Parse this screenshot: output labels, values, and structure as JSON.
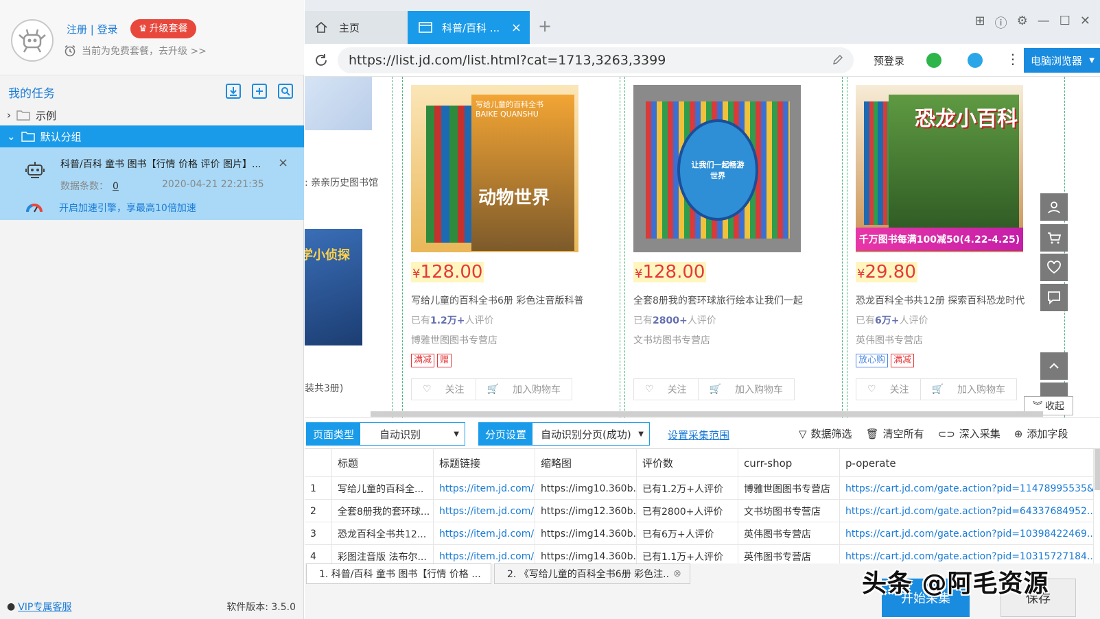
{
  "user": {
    "register": "注册",
    "sep": "|",
    "login": "登录",
    "upgrade": "升级套餐",
    "plan_text": "当前为免费套餐，去升级 >>"
  },
  "tasks": {
    "title": "我的任务",
    "example": "示例",
    "default_group": "默认分组",
    "task": {
      "title": "科普/百科 童书 图书【行情 价格 评价 图片】...",
      "count_label": "数据条数：",
      "count": "0",
      "time": "2020-04-21 22:21:35",
      "speed": "开启加速引擎，享最高10倍加速"
    }
  },
  "footer": {
    "vip": "VIP专属客服",
    "version": "软件版本: 3.5.0"
  },
  "browser": {
    "home_tab": "主页",
    "active_tab": "科普/百科 ...",
    "url": "https://list.jd.com/list.html?cat=1713,3263,3399",
    "prelogin": "预登录",
    "pc_browser": "电脑浏览器"
  },
  "web": {
    "left_shop": ": 亲亲历史图书馆",
    "left_note": "装共3册)",
    "left_book_title": "学小侦探",
    "products": [
      {
        "price_sym": "¥",
        "price": "128.00",
        "title": "写给儿童的百科全书6册 彩色注音版科普",
        "cmt_pre": "已有",
        "cmt": "1.2万+",
        "cmt_post": "人评价",
        "shop": "博雅世图图书专营店",
        "tags": [
          "满减",
          "赠"
        ],
        "follow": "关注",
        "cart": "加入购物车",
        "cover_title": "动物世界",
        "cover_sub": "写给儿童的百科全书",
        "cover_py": "BAIKE QUANSHU"
      },
      {
        "price_sym": "¥",
        "price": "128.00",
        "title": "全套8册我的套环球旅行绘本让我们一起",
        "cmt_pre": "已有",
        "cmt": "2800+",
        "cmt_post": "人评价",
        "shop": "文书坊图书专营店",
        "tags": [],
        "follow": "关注",
        "cart": "加入购物车",
        "cover_title": "让我们一起畅游世界"
      },
      {
        "price_sym": "¥",
        "price": "29.80",
        "title": "恐龙百科全书共12册 探索百科恐龙时代",
        "cmt_pre": "已有",
        "cmt": "6万+",
        "cmt_post": "人评价",
        "shop": "英伟图书专营店",
        "tags": [
          "放心购",
          "满减"
        ],
        "follow": "关注",
        "cart": "加入购物车",
        "cover_title": "恐龙小百科",
        "cover_banner": "千万图书每满100减50(4.22-4.25)"
      }
    ],
    "collapse": "收起"
  },
  "toolbar": {
    "page_type_label": "页面类型",
    "page_type_value": "自动识别",
    "paging_label": "分页设置",
    "paging_value": "自动识别分页(成功)",
    "range": "设置采集范围",
    "filter": "数据筛选",
    "clear": "清空所有",
    "deep": "深入采集",
    "add_field": "添加字段"
  },
  "table": {
    "headers": [
      "",
      "标题",
      "标题链接",
      "缩略图",
      "评价数",
      "curr-shop",
      "p-operate"
    ],
    "rows": [
      [
        "1",
        "写给儿童的百科全...",
        "https://item.jd.com/...",
        "https://img10.360b...",
        "已有1.2万+人评价",
        "博雅世图图书专营店",
        "https://cart.jd.com/gate.action?pid=11478995535&..."
      ],
      [
        "2",
        "全套8册我的套环球...",
        "https://item.jd.com/...",
        "https://img12.360b...",
        "已有2800+人评价",
        "文书坊图书专营店",
        "https://cart.jd.com/gate.action?pid=64337684952..."
      ],
      [
        "3",
        "恐龙百科全书共12...",
        "https://item.jd.com/...",
        "https://img14.360b...",
        "已有6万+人评价",
        "英伟图书专营店",
        "https://cart.jd.com/gate.action?pid=10398422469..."
      ],
      [
        "4",
        "彩图注音版 法布尔...",
        "https://item.jd.com/...",
        "https://img14.360b...",
        "已有1.1万+人评价",
        "英伟图书专营店",
        "https://cart.jd.com/gate.action?pid=10315727184..."
      ]
    ]
  },
  "bottom": {
    "tab1": "1. 科普/百科 童书 图书【行情 价格 ...",
    "tab2": "2. 《写给儿童的百科全书6册 彩色注...",
    "start": "开始采集",
    "save": "保存",
    "watermark": "头条 @阿毛资源"
  },
  "colors": {
    "accent": "#1a9be9",
    "price": "#e4393c",
    "upgrade": "#e8473c"
  }
}
